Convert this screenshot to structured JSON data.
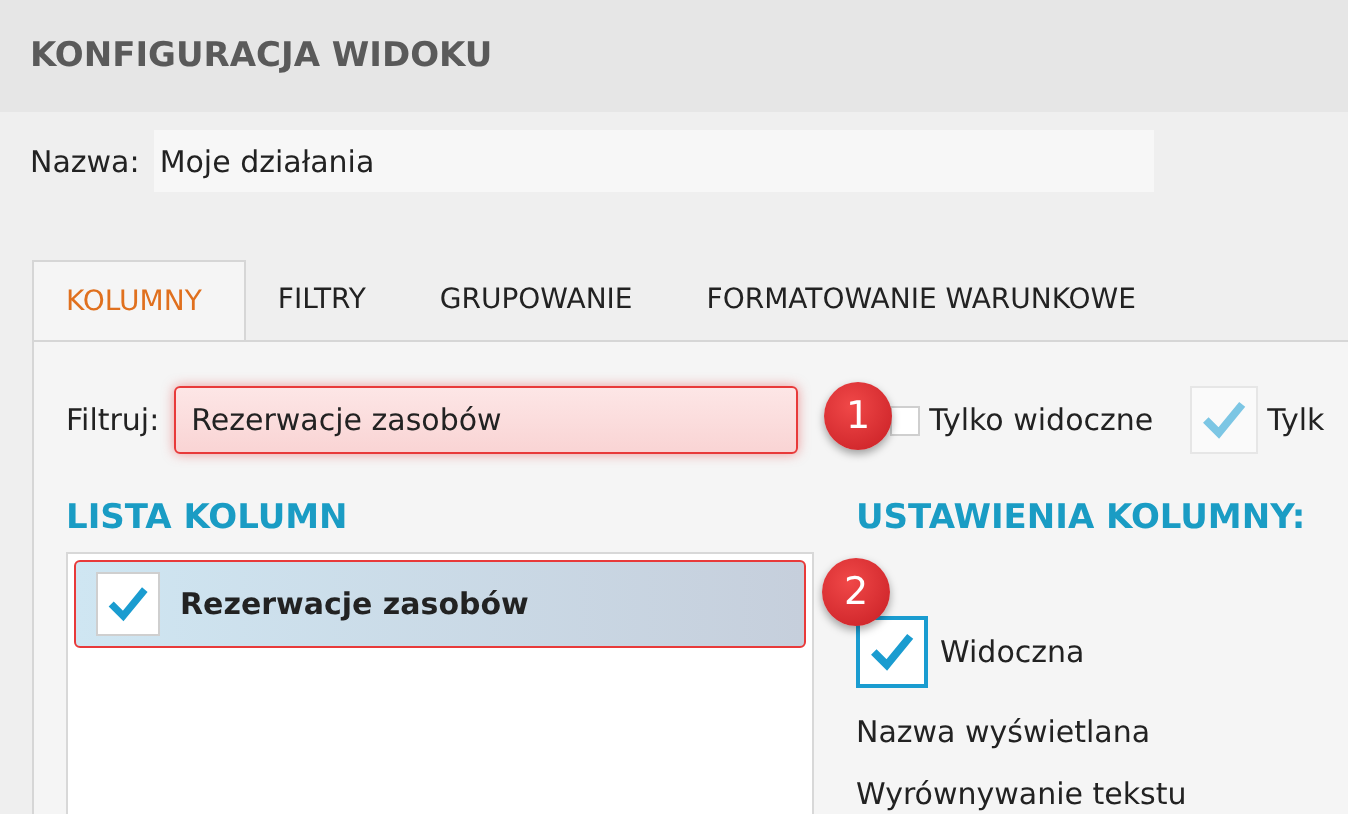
{
  "window": {
    "title": "KONFIGURACJA WIDOKU"
  },
  "name_field": {
    "label": "Nazwa:",
    "value": "Moje działania"
  },
  "tabs": [
    {
      "label": "KOLUMNY",
      "selected": true
    },
    {
      "label": "FILTRY",
      "selected": false
    },
    {
      "label": "GRUPOWANIE",
      "selected": false
    },
    {
      "label": "FORMATOWANIE WARUNKOWE",
      "selected": false
    }
  ],
  "filter": {
    "label": "Filtruj:",
    "value": "Rezerwacje zasobów",
    "callout": "1"
  },
  "filter_options": [
    {
      "label": "Tylko widoczne",
      "checked": false,
      "disabled": false
    },
    {
      "label": "Tylk",
      "checked": true,
      "disabled": true
    }
  ],
  "column_list": {
    "title": "LISTA KOLUMN",
    "items": [
      {
        "label": "Rezerwacje zasobów",
        "checked": true,
        "selected": true,
        "callout": "2"
      }
    ]
  },
  "column_settings": {
    "title": "USTAWIENIA KOLUMNY:",
    "visible": {
      "label": "Widoczna",
      "checked": true
    },
    "fields": [
      "Nazwa wyświetlana",
      "Wyrównywanie tekstu"
    ]
  }
}
